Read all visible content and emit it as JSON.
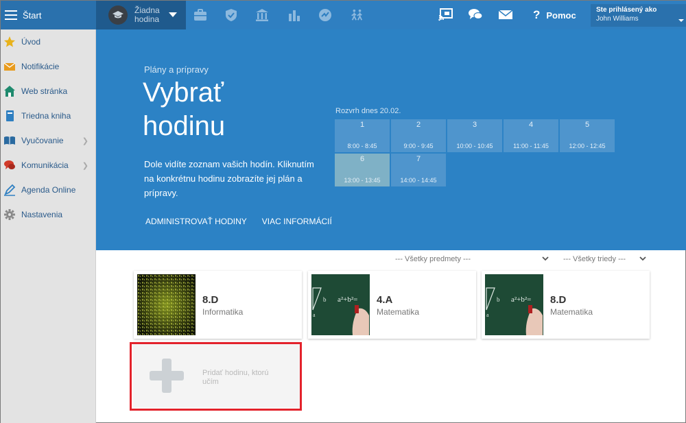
{
  "topbar": {
    "start_label": "Štart",
    "lesson_line1": "Žiadna",
    "lesson_line2": "hodina",
    "help_label": "Pomoc",
    "login_label": "Ste prihlásený ako",
    "user_name": "John Williams",
    "icons": [
      "briefcase-icon",
      "shield-check-icon",
      "bank-icon",
      "bar-chart-icon",
      "gauge-icon",
      "people-walking-icon",
      "cast-icon",
      "chat-bubbles-icon",
      "envelope-icon",
      "question-icon"
    ]
  },
  "sidebar": {
    "items": [
      {
        "label": "Úvod",
        "icon": "star-icon"
      },
      {
        "label": "Notifikácie",
        "icon": "envelope-icon"
      },
      {
        "label": "Web stránka",
        "icon": "home-icon"
      },
      {
        "label": "Triedna kniha",
        "icon": "book-icon"
      },
      {
        "label": "Vyučovanie",
        "icon": "open-book-icon",
        "has_submenu": true
      },
      {
        "label": "Komunikácia",
        "icon": "chat-icon",
        "has_submenu": true
      },
      {
        "label": "Agenda Online",
        "icon": "pen-icon"
      },
      {
        "label": "Nastavenia",
        "icon": "gear-icon"
      }
    ]
  },
  "hero": {
    "subtitle": "Plány a prípravy",
    "title": "Vybrať hodinu",
    "description": "Dole vidíte zoznam vašich hodín. Kliknutím na konkrétnu hodinu zobrazíte jej plán a prípravy.",
    "link_admin": "ADMINISTROVAŤ HODINY",
    "link_more": "VIAC INFORMÁCIÍ"
  },
  "schedule": {
    "title": "Rozvrh dnes 20.02.",
    "periods": [
      {
        "num": "1",
        "time": "8:00 - 8:45"
      },
      {
        "num": "2",
        "time": "9:00 - 9:45"
      },
      {
        "num": "3",
        "time": "10:00 - 10:45"
      },
      {
        "num": "4",
        "time": "11:00 - 11:45"
      },
      {
        "num": "5",
        "time": "12:00 - 12:45"
      },
      {
        "num": "6",
        "time": "13:00 - 13:45",
        "active": true
      },
      {
        "num": "7",
        "time": "14:00 - 14:45"
      }
    ]
  },
  "filters": {
    "subjects": "--- Všetky predmety ---",
    "classes": "--- Všetky triedy ---"
  },
  "cards": [
    {
      "class": "8.D",
      "subject": "Informatika",
      "thumb": "binary-code"
    },
    {
      "class": "4.A",
      "subject": "Matematika",
      "thumb": "chalkboard"
    },
    {
      "class": "8.D",
      "subject": "Matematika",
      "thumb": "chalkboard"
    }
  ],
  "add_card": {
    "label": "Pridať hodinu, ktorú učím"
  },
  "colors": {
    "topbar": "#2f7fc1",
    "hero": "#2c82c5",
    "highlight": "#e3222b"
  }
}
